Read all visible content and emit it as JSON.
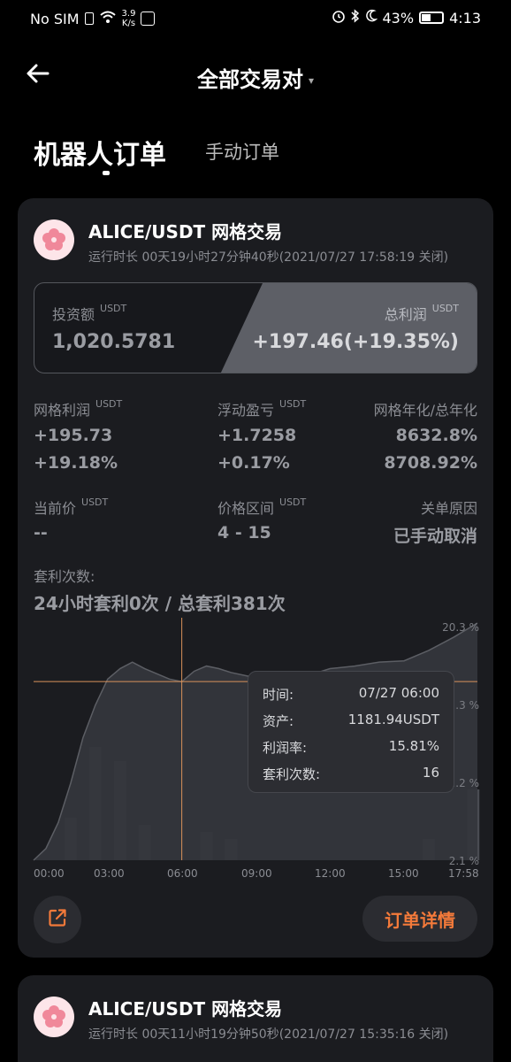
{
  "status_bar": {
    "carrier": "No SIM",
    "speed_value": "3.9",
    "speed_unit": "K/s",
    "battery": "43%",
    "time": "4:13"
  },
  "header": {
    "title": "全部交易对",
    "caret": "▾"
  },
  "tabs": {
    "active": "机器人订单",
    "inactive": "手动订单"
  },
  "card1": {
    "pair": "ALICE/USDT 网格交易",
    "runtime": "运行时长 00天19小时27分钟40秒(2021/07/27 17:58:19 关闭)",
    "invest_label": "投资额",
    "invest_unit": "USDT",
    "invest_value": "1,020.5781",
    "profit_label": "总利润",
    "profit_unit": "USDT",
    "profit_value": "+197.46(+19.35%)",
    "grid_profit_label": "网格利润",
    "grid_profit_unit": "USDT",
    "grid_profit_value": "+195.73",
    "grid_profit_pct": "+19.18%",
    "float_label": "浮动盈亏",
    "float_unit": "USDT",
    "float_value": "+1.7258",
    "float_pct": "+0.17%",
    "annual_label": "网格年化/总年化",
    "annual_grid": "8632.8%",
    "annual_total": "8708.92%",
    "price_label": "当前价",
    "price_unit": "USDT",
    "price_value": "--",
    "range_label": "价格区间",
    "range_unit": "USDT",
    "range_value": "4 - 15",
    "close_label": "关单原因",
    "close_value": "已手动取消",
    "arb_label": "套利次数:",
    "arb_value": "24小时套利0次 / 总套利381次",
    "detail_button": "订单详情"
  },
  "tooltip": {
    "time_label": "时间:",
    "time_value": "07/27 06:00",
    "asset_label": "资产:",
    "asset_value": "1181.94USDT",
    "rate_label": "利润率:",
    "rate_value": "15.81%",
    "arb_label": "套利次数:",
    "arb_value": "16"
  },
  "chart_data": {
    "type": "area",
    "x_ticks": [
      "00:00",
      "03:00",
      "06:00",
      "09:00",
      "12:00",
      "15:00",
      "17:58"
    ],
    "y_ticks": [
      "20.3 %",
      "…3 %",
      "…2 %",
      "2.1 %"
    ],
    "series": [
      {
        "values": [
          [
            0,
            2.1
          ],
          [
            0.5,
            3.0
          ],
          [
            1,
            5.0
          ],
          [
            1.5,
            8.0
          ],
          [
            2,
            11.5
          ],
          [
            2.5,
            14.0
          ],
          [
            3,
            16.0
          ],
          [
            3.5,
            16.8
          ],
          [
            4,
            17.3
          ],
          [
            4.5,
            16.8
          ],
          [
            5,
            16.4
          ],
          [
            5.5,
            16.0
          ],
          [
            6,
            15.8
          ],
          [
            6.5,
            16.6
          ],
          [
            7,
            17.0
          ],
          [
            7.5,
            16.8
          ],
          [
            8,
            16.5
          ],
          [
            9,
            16.1
          ],
          [
            10,
            16.0
          ],
          [
            11,
            16.2
          ],
          [
            12,
            16.8
          ],
          [
            13,
            17.0
          ],
          [
            14,
            17.3
          ],
          [
            15,
            17.4
          ],
          [
            16,
            18.2
          ],
          [
            17,
            19.2
          ],
          [
            17.97,
            20.3
          ]
        ]
      },
      {
        "bars": [
          [
            1.5,
            6
          ],
          [
            2.5,
            16
          ],
          [
            3.5,
            14
          ],
          [
            4.5,
            5
          ],
          [
            7,
            4
          ],
          [
            8,
            3
          ],
          [
            16,
            3
          ],
          [
            17.8,
            10
          ]
        ]
      }
    ],
    "crosshair": {
      "x": 6,
      "y": 15.81
    },
    "xlabel": "",
    "ylabel": ""
  },
  "card2": {
    "pair": "ALICE/USDT 网格交易",
    "runtime": "运行时长 00天11小时19分钟50秒(2021/07/27 15:35:16 关闭)"
  },
  "icons": [
    "back-arrow-icon",
    "wifi-icon",
    "alarm-icon",
    "bluetooth-icon",
    "moon-icon",
    "battery-icon",
    "flower-avatar-icon",
    "share-icon"
  ],
  "colors": {
    "accent": "#f47a3a",
    "card_bg": "#1b1c20",
    "muted_text": "#8b8d93",
    "crosshair": "#d9925a"
  }
}
